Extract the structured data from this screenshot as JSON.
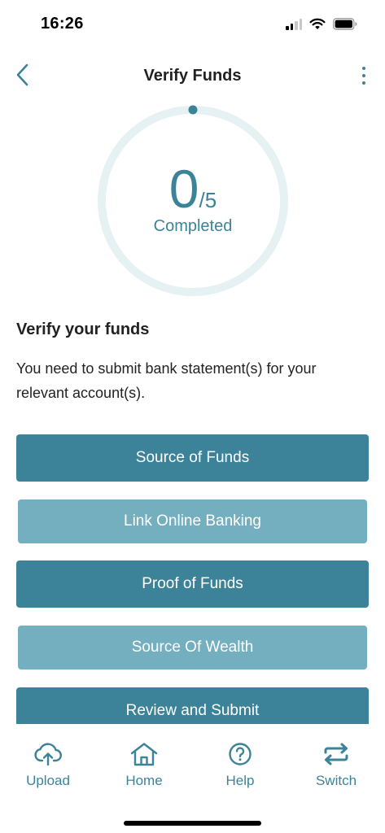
{
  "status_bar": {
    "time": "16:26"
  },
  "header": {
    "title": "Verify Funds"
  },
  "progress": {
    "completed": "0",
    "total_text": "/5",
    "label": "Completed",
    "fraction": 0
  },
  "content": {
    "heading": "Verify your funds",
    "description": "You need to submit bank statement(s) for your relevant account(s)."
  },
  "actions": [
    {
      "label": "Source of Funds",
      "style": "dark"
    },
    {
      "label": "Link Online Banking",
      "style": "light"
    },
    {
      "label": "Proof of Funds",
      "style": "dark"
    },
    {
      "label": "Source Of Wealth",
      "style": "light"
    },
    {
      "label": "Review and Submit",
      "style": "dark"
    }
  ],
  "tab_bar": {
    "tabs": [
      {
        "label": "Upload",
        "icon": "cloud-upload-icon"
      },
      {
        "label": "Home",
        "icon": "home-icon"
      },
      {
        "label": "Help",
        "icon": "help-icon"
      },
      {
        "label": "Switch",
        "icon": "switch-icon"
      }
    ]
  },
  "colors": {
    "accent": "#3c8399",
    "accent_light": "#74afc0",
    "ring_track": "#e6f1f4"
  }
}
